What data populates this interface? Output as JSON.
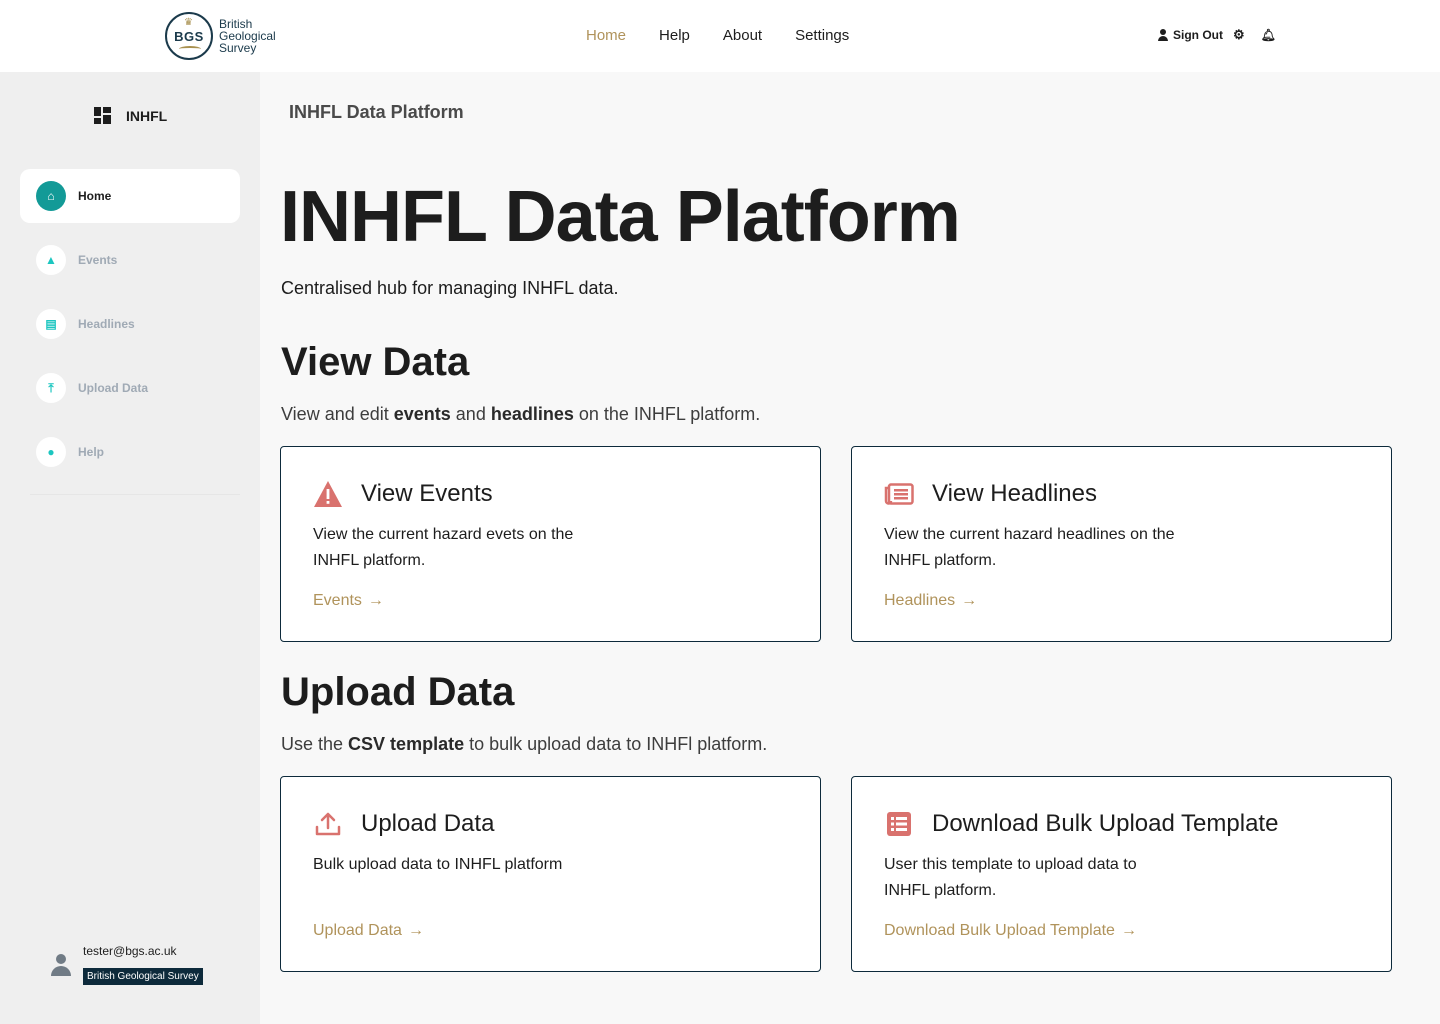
{
  "brand": {
    "seal_text": "BGS",
    "name_lines": [
      "British",
      "Geological",
      "Survey"
    ]
  },
  "nav": {
    "items": [
      "Home",
      "Help",
      "About",
      "Settings"
    ],
    "active": "Home"
  },
  "top_actions": {
    "sign_out": "Sign Out"
  },
  "sidebar": {
    "title": "INHFL",
    "items": [
      {
        "label": "Home",
        "icon": "home-icon",
        "active": true
      },
      {
        "label": "Events",
        "icon": "warning-icon",
        "active": false
      },
      {
        "label": "Headlines",
        "icon": "newspaper-icon",
        "active": false
      },
      {
        "label": "Upload Data",
        "icon": "upload-icon",
        "active": false
      },
      {
        "label": "Help",
        "icon": "info-icon",
        "active": false
      }
    ],
    "user": {
      "email": "tester@bgs.ac.uk",
      "org": "British Geological Survey"
    }
  },
  "main": {
    "breadcrumb": "INHFL Data Platform",
    "title": "INHFL Data Platform",
    "subtitle": "Centralised hub for managing INHFL data.",
    "view_section": {
      "title": "View Data",
      "desc_parts": [
        "View and edit ",
        "events",
        " and ",
        "headlines",
        " on the INHFL platform."
      ],
      "cards": [
        {
          "title": "View Events",
          "text": "View the current hazard evets on the INHFL platform.",
          "link": "Events",
          "icon": "warning-icon"
        },
        {
          "title": "View Headlines",
          "text": "View the current hazard headlines on the INHFL platform.",
          "link": "Headlines",
          "icon": "newspaper-icon"
        }
      ]
    },
    "upload_section": {
      "title": "Upload Data",
      "desc_parts": [
        "Use the ",
        "CSV template",
        " to bulk upload data to INHFl platform."
      ],
      "cards": [
        {
          "title": "Upload Data",
          "text": "Bulk upload data to INHFL platform",
          "link": "Upload Data",
          "icon": "upload-icon"
        },
        {
          "title": "Download Bulk Upload Template",
          "text": "User this template to upload data to INHFL platform.",
          "link": "Download Bulk Upload Template",
          "icon": "list-icon"
        }
      ]
    }
  },
  "colors": {
    "accent_gold": "#b0935b",
    "teal": "#139a97",
    "icon_red": "#d9726e",
    "navy": "#0d2a3b"
  }
}
